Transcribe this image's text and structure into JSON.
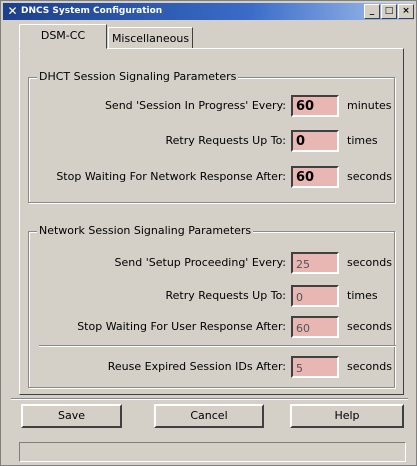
{
  "window": {
    "title": "DNCS System Configuration",
    "minimize_glyph": "_",
    "maximize_glyph": "□",
    "close_glyph": "×",
    "app_icon": "x-logo-icon"
  },
  "tabs": [
    {
      "label": "DSM-CC",
      "active": true
    },
    {
      "label": "Miscellaneous",
      "active": false
    }
  ],
  "dhct_group": {
    "title": "DHCT Session Signaling Parameters",
    "rows": [
      {
        "label": "Send 'Session In Progress' Every:",
        "value": "60",
        "unit": "minutes"
      },
      {
        "label": "Retry Requests Up To:",
        "value": "0",
        "unit": "times"
      },
      {
        "label": "Stop Waiting For Network Response After:",
        "value": "60",
        "unit": "seconds"
      }
    ]
  },
  "network_group": {
    "title": "Network Session Signaling Parameters",
    "rows": [
      {
        "label": "Send 'Setup Proceeding' Every:",
        "value": "25",
        "unit": "seconds"
      },
      {
        "label": "Retry Requests Up To:",
        "value": "0",
        "unit": "times"
      },
      {
        "label": "Stop Waiting For User Response After:",
        "value": "60",
        "unit": "seconds"
      },
      {
        "label": "Reuse Expired Session IDs After:",
        "value": "5",
        "unit": "seconds"
      }
    ]
  },
  "buttons": {
    "save": "Save",
    "cancel": "Cancel",
    "help": "Help"
  },
  "status": "",
  "colors": {
    "field_bg": "#e8b7b4",
    "window_bg": "#d4d0c8",
    "titlebar": "#1c3f8a"
  }
}
